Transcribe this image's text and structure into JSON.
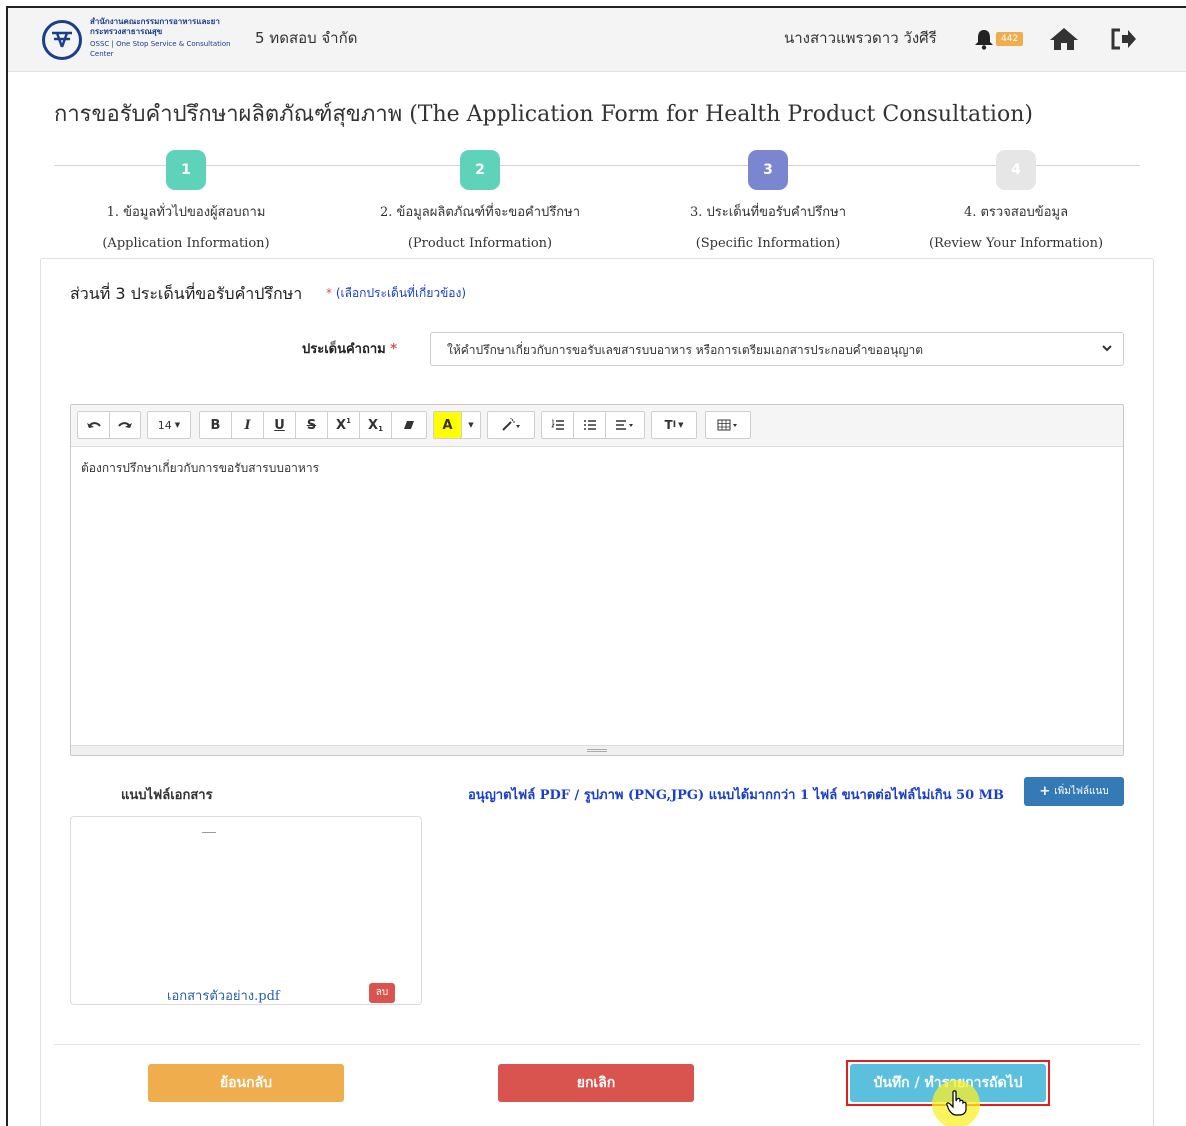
{
  "header": {
    "logo_line1": "สำนักงานคณะกรรมการอาหารและยา",
    "logo_line2": "กระทรวงสาธารณสุข",
    "logo_line3": "OSSC | One Stop Service & Consultation Center",
    "company": "5 ทดสอบ จำกัด",
    "user_name": "นางสาวแพรวดาว วังศีรี",
    "notification_count": "442",
    "icons": [
      "bell-icon",
      "home-icon",
      "logout-icon"
    ]
  },
  "page": {
    "title": "การขอรับคำปรึกษาผลิตภัณฑ์สุขภาพ (The Application Form for Health Product Consultation)"
  },
  "steps": [
    {
      "number": "1",
      "label": "1. ข้อมูลทั่วไปของผู้สอบถาม",
      "sub": "(Application Information)",
      "color": "#5fd3b9"
    },
    {
      "number": "2",
      "label": "2. ข้อมูลผลิตภัณฑ์ที่จะขอคำปรึกษา",
      "sub": "(Product Information)",
      "color": "#5fd3b9"
    },
    {
      "number": "3",
      "label": "3. ประเด็นที่ขอรับคำปรึกษา",
      "sub": "(Specific Information)",
      "color": "#7a86d0"
    },
    {
      "number": "4",
      "label": "4. ตรวจสอบข้อมูล",
      "sub": "(Review Your Information)",
      "color": "#e6e6e6"
    }
  ],
  "section": {
    "title": "ส่วนที่ 3 ประเด็นที่ขอรับคำปรึกษา",
    "hint_mark": "*",
    "hint": "(เลือกประเด็นที่เกี่ยวข้อง)"
  },
  "question": {
    "label": "ประเด็นคำถาม",
    "required_mark": "*",
    "selected": "ให้คำปรึกษาเกี่ยวกับการขอรับเลขสารบบอาหาร หรือการเตรียมเอกสารประกอบคำขออนุญาต"
  },
  "editor": {
    "font_size": "14",
    "content": "ต้องการปรึกษาเกี่ยวกับการขอรับสารบบอาหาร"
  },
  "attachments": {
    "label": "แนบไฟล์เอกสาร",
    "note": "อนุญาตไฟล์ PDF / รูปภาพ (PNG,JPG) แนบได้มากกว่า 1 ไฟล์ ขนาดต่อไฟล์ไม่เกิน 50 MB",
    "add_button": "เพิ่มไฟล์แนบ",
    "file_name": "เอกสารตัวอย่าง.pdf",
    "delete_button": "ลบ"
  },
  "actions": {
    "back": "ย้อนกลับ",
    "cancel": "ยกเลิก",
    "next": "บันทึก / ทำรายการถัดไป"
  },
  "colors": {
    "step_done": "#5fd3b9",
    "step_current": "#7a86d0",
    "step_pending": "#e6e6e6",
    "back": "#f0ad4e",
    "cancel": "#d9534f",
    "next": "#5bc0de",
    "add_file": "#337ab7"
  }
}
